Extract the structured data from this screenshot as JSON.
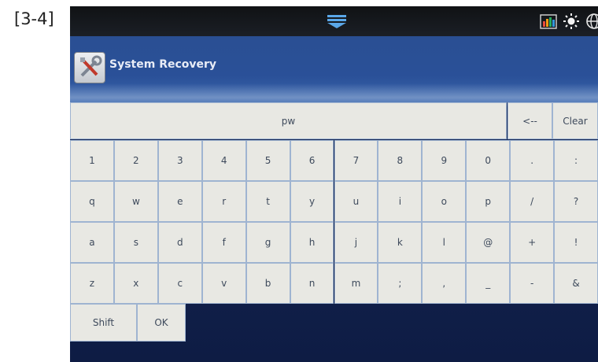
{
  "figure_label": "[3-4]",
  "app": {
    "title": "System Recovery"
  },
  "input": {
    "value": "pw"
  },
  "controls": {
    "backspace": "<--",
    "clear": "Clear",
    "shift": "Shift",
    "ok": "OK"
  },
  "keyboard": {
    "rows": [
      [
        "1",
        "2",
        "3",
        "4",
        "5",
        "6",
        "7",
        "8",
        "9",
        "0",
        ".",
        ":"
      ],
      [
        "q",
        "w",
        "e",
        "r",
        "t",
        "y",
        "u",
        "i",
        "o",
        "p",
        "/",
        "?"
      ],
      [
        "a",
        "s",
        "d",
        "f",
        "g",
        "h",
        "j",
        "k",
        "l",
        "@",
        "+",
        "!"
      ],
      [
        "z",
        "x",
        "c",
        "v",
        "b",
        "n",
        "m",
        ";",
        ",",
        "_",
        "-",
        "&"
      ]
    ]
  },
  "status_icons": [
    "bar-chart-icon",
    "brightness-icon",
    "globe-icon"
  ]
}
